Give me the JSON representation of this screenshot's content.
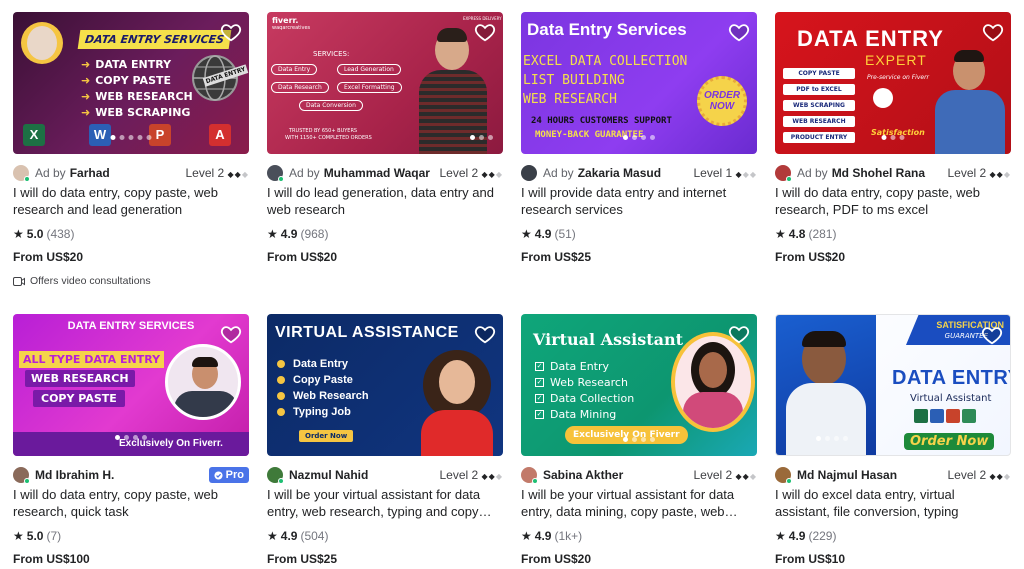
{
  "colors": {
    "online": "#1dbf73",
    "pro_badge": "#4a73e8",
    "star": "#222325"
  },
  "gigs": [
    {
      "thumb": {
        "headline": "DATA ENTRY SERVICES",
        "lines": [
          "DATA ENTRY",
          "COPY PASTE",
          "WEB RESEARCH",
          "WEB SCRAPING"
        ],
        "tag": "DATA ENTRY",
        "icon_labels": [
          "X",
          "W",
          "P",
          "A"
        ]
      },
      "ad_label": "Ad by",
      "seller": "Farhad",
      "level": "Level 2",
      "title": "I will do data entry, copy paste, web research and lead generation",
      "rating": "5.0",
      "reviews": "(438)",
      "price": "From US$20",
      "extra": "Offers video consultations"
    },
    {
      "thumb": {
        "brand": "fiverr.",
        "handle": "waqarcreatives",
        "corner": "EXPRESS DELIVERY",
        "services_title": "SERVICES:",
        "pills": [
          "Data Entry",
          "Lead Generation",
          "Data Research",
          "Excel Formatting",
          "Data Conversion"
        ],
        "trust_line1": "TRUSTED BY 650+ BUYERS",
        "trust_line2": "WITH 1150+ COMPLETED ORDERS"
      },
      "ad_label": "Ad by",
      "seller": "Muhammad Waqar",
      "level": "Level 2",
      "title": "I will do lead generation, data entry and web research",
      "rating": "4.9",
      "reviews": "(968)",
      "price": "From US$20"
    },
    {
      "thumb": {
        "headline": "Data Entry Services",
        "lines": [
          "EXCEL DATA COLLECTION",
          "LIST BUILDING",
          "WEB RESEARCH"
        ],
        "support": "24 HOURS CUSTOMERS SUPPORT",
        "guarantee": "MONEY-BACK GUARANTEE",
        "badge": "ORDER NOW"
      },
      "ad_label": "Ad by",
      "seller": "Zakaria Masud",
      "level": "Level 1",
      "title": "I will provide data entry and internet research services",
      "rating": "4.9",
      "reviews": "(51)",
      "price": "From US$25"
    },
    {
      "thumb": {
        "headline": "DATA ENTRY",
        "sub": "EXPERT",
        "pills": [
          "COPY PASTE",
          "PDF to EXCEL",
          "WEB SCRAPING",
          "WEB RESEARCH",
          "PRODUCT ENTRY"
        ],
        "tagline": "Pre-service on Fiverr",
        "stamp": "Satisfaction"
      },
      "ad_label": "Ad by",
      "seller": "Md Shohel Rana",
      "level": "Level 2",
      "title": "I will do data entry, copy paste, web research, PDF to ms excel",
      "rating": "4.8",
      "reviews": "(281)",
      "price": "From US$20"
    },
    {
      "thumb": {
        "headline": "DATA ENTRY SERVICES",
        "lines": [
          "ALL TYPE DATA ENTRY",
          "WEB RESEARCH",
          "COPY PASTE"
        ],
        "footer": "Exclusively On Fiverr."
      },
      "seller": "Md Ibrahim H.",
      "pro": "Pro",
      "title": "I will do data entry, copy paste, web research, quick task",
      "rating": "5.0",
      "reviews": "(7)",
      "price": "From US$100"
    },
    {
      "thumb": {
        "headline": "VIRTUAL ASSISTANCE",
        "lines": [
          "Data Entry",
          "Copy Paste",
          "Web Research",
          "Typing Job"
        ],
        "button": "Order Now"
      },
      "seller": "Nazmul Nahid",
      "level": "Level 2",
      "title": "I will be your virtual assistant for data entry, web research, typing and copy…",
      "rating": "4.9",
      "reviews": "(504)",
      "price": "From US$25"
    },
    {
      "thumb": {
        "headline": "Virtual Assistant",
        "lines": [
          "Data Entry",
          "Web Research",
          "Data Collection",
          "Data Mining"
        ],
        "footer": "Exclusively On Fiverr"
      },
      "seller": "Sabina Akther",
      "level": "Level 2",
      "title": "I will be your virtual assistant for data entry, data mining, copy paste, web…",
      "rating": "4.9",
      "reviews": "(1k+)",
      "price": "From US$20"
    },
    {
      "thumb": {
        "ribbon1": "SATISFICATION",
        "ribbon2": "GUARANTEE",
        "headline": "DATA ENTRY",
        "sub": "Virtual Assistant",
        "button": "Order Now"
      },
      "seller": "Md Najmul Hasan",
      "level": "Level 2",
      "title": "I will do excel data entry, virtual assistant, file conversion, typing",
      "rating": "4.9",
      "reviews": "(229)",
      "price": "From US$10"
    }
  ]
}
